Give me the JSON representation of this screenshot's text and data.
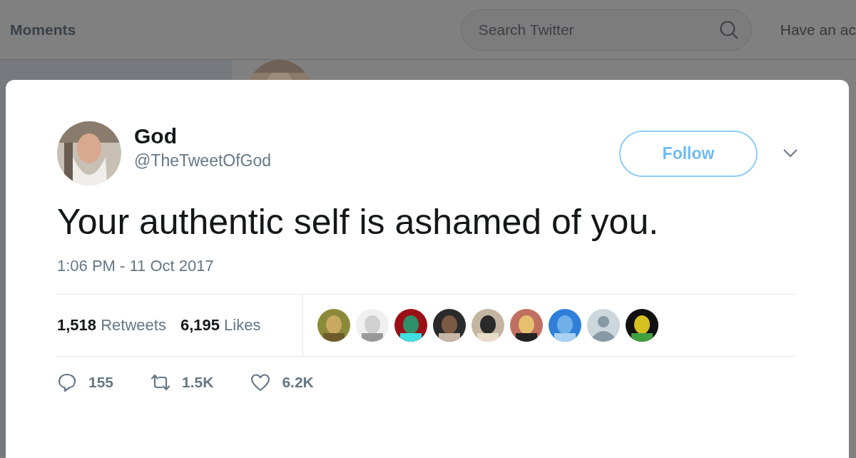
{
  "header": {
    "nav_item": "Moments",
    "search": {
      "placeholder": "Search Twitter"
    },
    "account_prompt": "Have an ac"
  },
  "tweet": {
    "author": {
      "name": "God",
      "handle": "@TheTweetOfGod"
    },
    "follow_button": "Follow",
    "text": "Your authentic self is ashamed of you.",
    "timestamp": "1:06 PM - 11 Oct 2017",
    "stats": [
      {
        "count": "1,518",
        "label": "Retweets"
      },
      {
        "count": "6,195",
        "label": "Likes"
      }
    ],
    "likers": [
      {
        "kind": "picture"
      },
      {
        "kind": "picture"
      },
      {
        "kind": "picture"
      },
      {
        "kind": "picture"
      },
      {
        "kind": "picture"
      },
      {
        "kind": "picture"
      },
      {
        "kind": "picture"
      },
      {
        "kind": "default"
      },
      {
        "kind": "picture"
      }
    ],
    "actions": [
      {
        "kind": "reply",
        "count": "155"
      },
      {
        "kind": "retweet",
        "count": "1.5K"
      },
      {
        "kind": "like",
        "count": "6.2K"
      }
    ]
  }
}
